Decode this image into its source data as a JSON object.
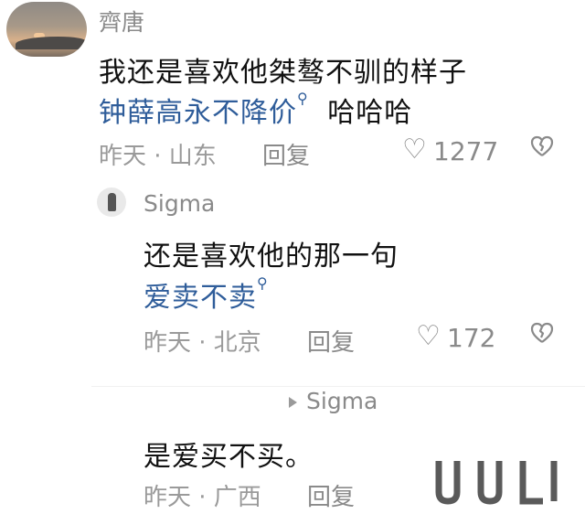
{
  "comments": [
    {
      "user": "齊唐",
      "text": "我还是喜欢他桀骜不驯的样子",
      "link_text": "钟薛高永不降价",
      "text_after_link": "哈哈哈",
      "meta": "昨天 · 山东",
      "reply_label": "回复",
      "likes": "1277"
    },
    {
      "user": "Sigma",
      "text": "还是喜欢他的那一句",
      "link_text": "爱卖不卖",
      "meta": "昨天 · 北京",
      "reply_label": "回复",
      "likes": "172"
    },
    {
      "user": "Sigma",
      "text": "是爱买不买。",
      "meta": "昨天 · 广西",
      "reply_label": "回复"
    }
  ],
  "watermark": "U U L",
  "icons": {
    "heart": "heart-outline-icon",
    "dislike": "broken-heart-icon",
    "search": "search-icon",
    "reply_arrow": "triangle-right-icon"
  },
  "colors": {
    "link": "#2f5d9a",
    "muted": "#8a8a8a"
  }
}
